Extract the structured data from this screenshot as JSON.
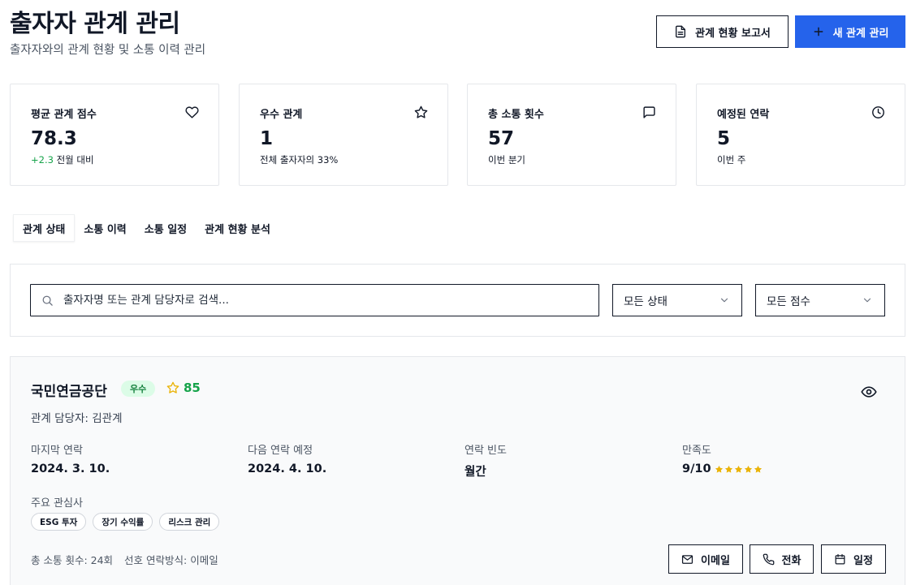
{
  "header": {
    "title": "출자자 관계 관리",
    "subtitle": "출자자와의 관계 현황 및 소통 이력 관리",
    "report_button": "관계 현황 보고서",
    "new_button": "새 관계 관리"
  },
  "stats": [
    {
      "label": "평균 관계 점수",
      "value": "78.3",
      "delta": "+2.3",
      "sub": " 전월 대비",
      "icon": "heart-icon"
    },
    {
      "label": "우수 관계",
      "value": "1",
      "sub": "전체 출자자의 33%",
      "icon": "star-icon"
    },
    {
      "label": "총 소통 횟수",
      "value": "57",
      "sub": "이번 분기",
      "icon": "message-icon"
    },
    {
      "label": "예정된 연락",
      "value": "5",
      "sub": "이번 주",
      "icon": "clock-icon"
    }
  ],
  "tabs": [
    {
      "label": "관계 상태",
      "active": true
    },
    {
      "label": "소통 이력",
      "active": false
    },
    {
      "label": "소통 일정",
      "active": false
    },
    {
      "label": "관계 현황 분석",
      "active": false
    }
  ],
  "filters": {
    "search_placeholder": "출자자명 또는 관계 담당자로 검색...",
    "status_selected": "모든 상태",
    "score_selected": "모든 점수"
  },
  "investor": {
    "name": "국민연금공단",
    "badge": "우수",
    "score": "85",
    "manager": "관계 담당자: 김관계",
    "last_contact_label": "마지막 연락",
    "last_contact": "2024. 3. 10.",
    "next_contact_label": "다음 연락 예정",
    "next_contact": "2024. 4. 10.",
    "frequency_label": "연락 빈도",
    "frequency": "월간",
    "satisfaction_label": "만족도",
    "satisfaction": "9/10",
    "satisfaction_stars": 5,
    "interests_label": "주요 관심사",
    "interests": [
      "ESG 투자",
      "장기 수익률",
      "리스크 관리"
    ],
    "total_contacts": "총 소통 횟수: 24회",
    "preferred_contact": "선호 연락방식: 이메일",
    "email_button": "이메일",
    "phone_button": "전화",
    "schedule_button": "일정"
  },
  "colors": {
    "primary": "#2563eb",
    "success": "#16a34a",
    "badge_bg": "#dcfce7",
    "star": "#eab308"
  }
}
